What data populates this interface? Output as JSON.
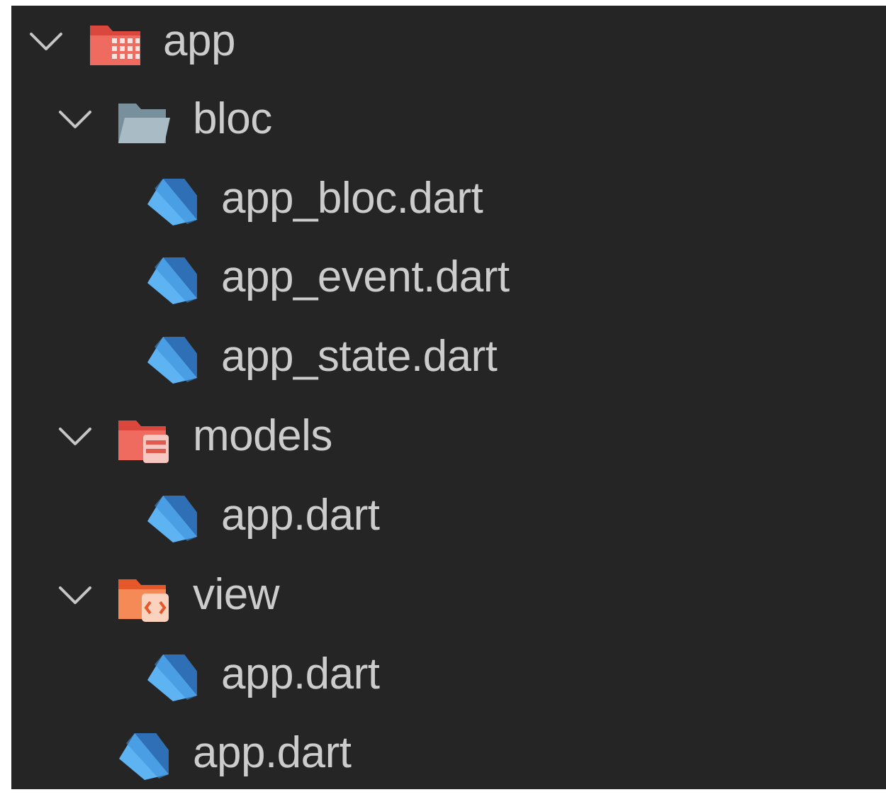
{
  "tree": [
    {
      "label": "app",
      "depth": 0,
      "kind": "folder",
      "icon": "folder-app-icon",
      "expanded": true,
      "color": "#e05a4f"
    },
    {
      "label": "bloc",
      "depth": 1,
      "kind": "folder",
      "icon": "folder-icon",
      "expanded": true,
      "color": "#90a4ae"
    },
    {
      "label": "app_bloc.dart",
      "depth": 2,
      "kind": "file",
      "icon": "dart-file-icon",
      "color": "#42a5f5"
    },
    {
      "label": "app_event.dart",
      "depth": 2,
      "kind": "file",
      "icon": "dart-file-icon",
      "color": "#42a5f5"
    },
    {
      "label": "app_state.dart",
      "depth": 2,
      "kind": "file",
      "icon": "dart-file-icon",
      "color": "#42a5f5"
    },
    {
      "label": "models",
      "depth": 1,
      "kind": "folder",
      "icon": "folder-models-icon",
      "expanded": true,
      "color": "#e05a4f"
    },
    {
      "label": "app.dart",
      "depth": 2,
      "kind": "file",
      "icon": "dart-file-icon",
      "color": "#42a5f5"
    },
    {
      "label": "view",
      "depth": 1,
      "kind": "folder",
      "icon": "folder-view-icon",
      "expanded": true,
      "color": "#f0703a"
    },
    {
      "label": "app.dart",
      "depth": 2,
      "kind": "file",
      "icon": "dart-file-icon",
      "color": "#42a5f5"
    },
    {
      "label": "app.dart",
      "depth": 1,
      "kind": "file",
      "icon": "dart-file-icon",
      "color": "#42a5f5"
    }
  ]
}
